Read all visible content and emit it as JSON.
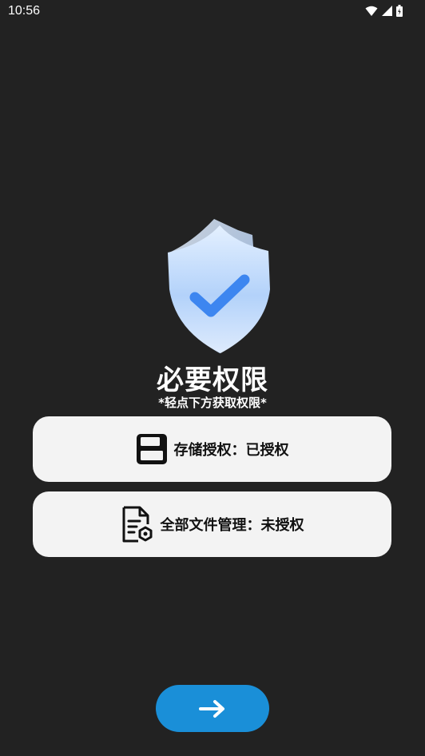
{
  "status_bar": {
    "time": "10:56",
    "icons": [
      "wifi-icon",
      "cellular-signal-icon",
      "battery-icon"
    ]
  },
  "header": {
    "title": "必要权限",
    "subtitle": "*轻点下方获取权限*"
  },
  "permissions": [
    {
      "label": "存储授权：已授权",
      "icon": "floppy-disk-icon",
      "status": "granted"
    },
    {
      "label": "全部文件管理：未授权",
      "icon": "file-settings-icon",
      "status": "not-granted"
    }
  ],
  "colors": {
    "background": "#222222",
    "card": "#f3f3f3",
    "button": "#1a8fd8",
    "shield_check": "#3d86f0"
  },
  "actions": {
    "next_icon": "arrow-right-icon"
  }
}
